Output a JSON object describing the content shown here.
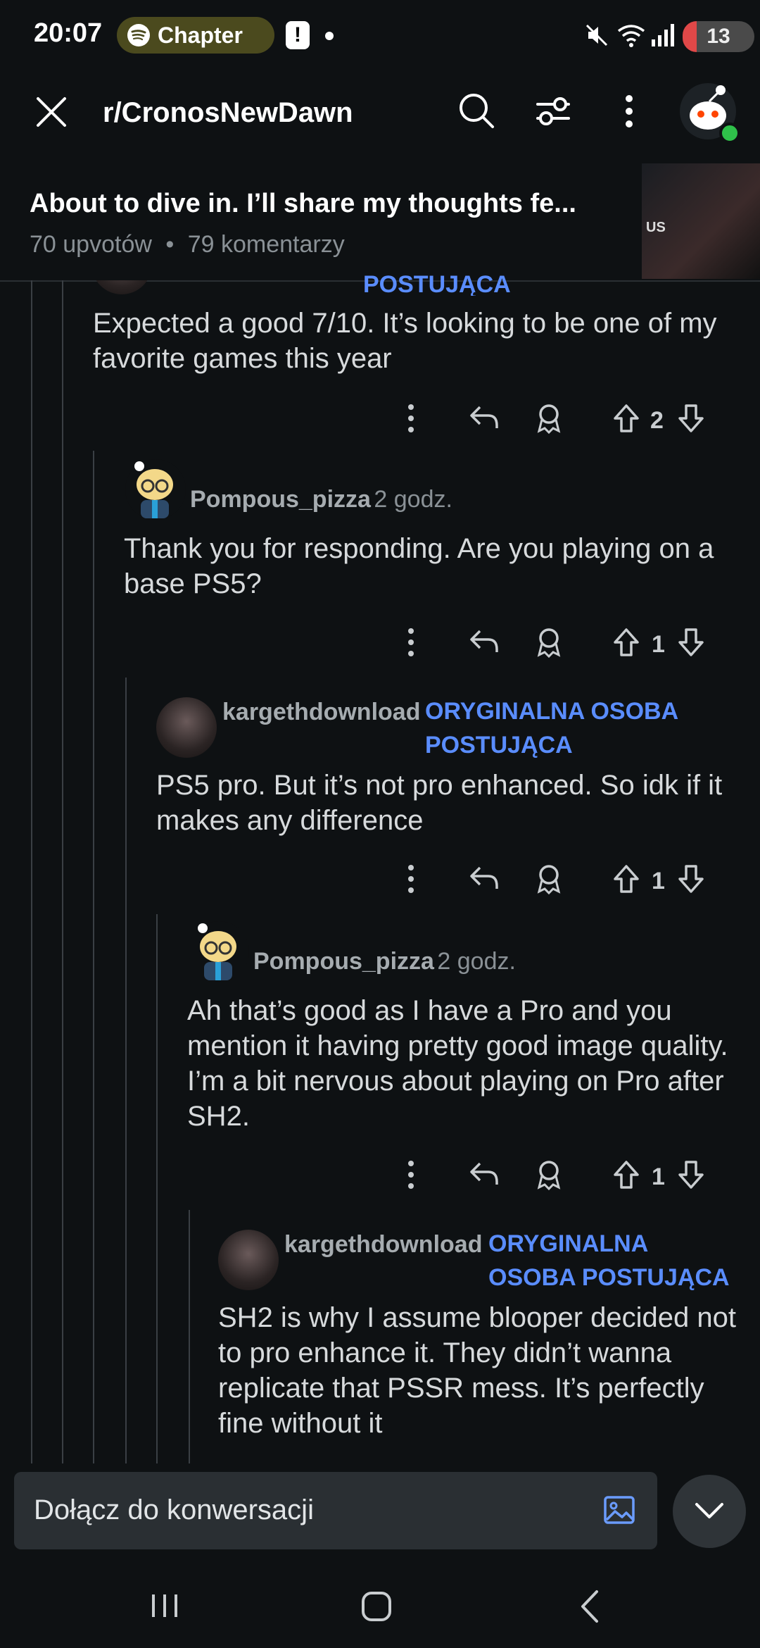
{
  "status_bar": {
    "time": "20:07",
    "media_label": "Chapter",
    "battery": "13"
  },
  "header": {
    "subreddit": "r/CronosNewDawn",
    "icons": [
      "close-icon",
      "search-icon",
      "filter-icon",
      "more-icon"
    ]
  },
  "post": {
    "title": "About to dive in. I’ll share my thoughts fe...",
    "upvotes": "70 upvotów",
    "separator": "•",
    "comments": "79 komentarzy"
  },
  "comments": [
    {
      "op_tail": "POSTUJĄCA",
      "text": "Expected a good 7/10. It’s looking to be one of my favorite games this year",
      "votes": "2"
    },
    {
      "user": "Pompous_pizza",
      "time": "2 godz.",
      "text": "Thank you for responding. Are you playing on a base PS5?",
      "votes": "1"
    },
    {
      "user": "kargethdownload",
      "op_line1": "ORYGINALNA OSOBA",
      "op_line2": "POSTUJĄCA",
      "text": "PS5 pro. But it’s not pro enhanced. So idk if it makes any difference",
      "votes": "1"
    },
    {
      "user": "Pompous_pizza",
      "time": "2 godz.",
      "text": "Ah that’s good as I have a Pro and you mention it having pretty good image quality. I’m a bit nervous about playing on Pro after SH2.",
      "votes": "1"
    },
    {
      "user": "kargethdownload",
      "op_line1": "ORYGINALNA",
      "op_line2": "OSOBA POSTUJĄCA",
      "text": "SH2 is why I assume blooper decided not to pro enhance it. They didn’t wanna replicate that PSSR mess. It’s perfectly fine without it"
    }
  ],
  "composer": {
    "placeholder": "Dołącz do konwersacji"
  },
  "colors": {
    "background": "#0e1113",
    "op_badge": "#5a8dff",
    "online": "#2fc14a"
  }
}
